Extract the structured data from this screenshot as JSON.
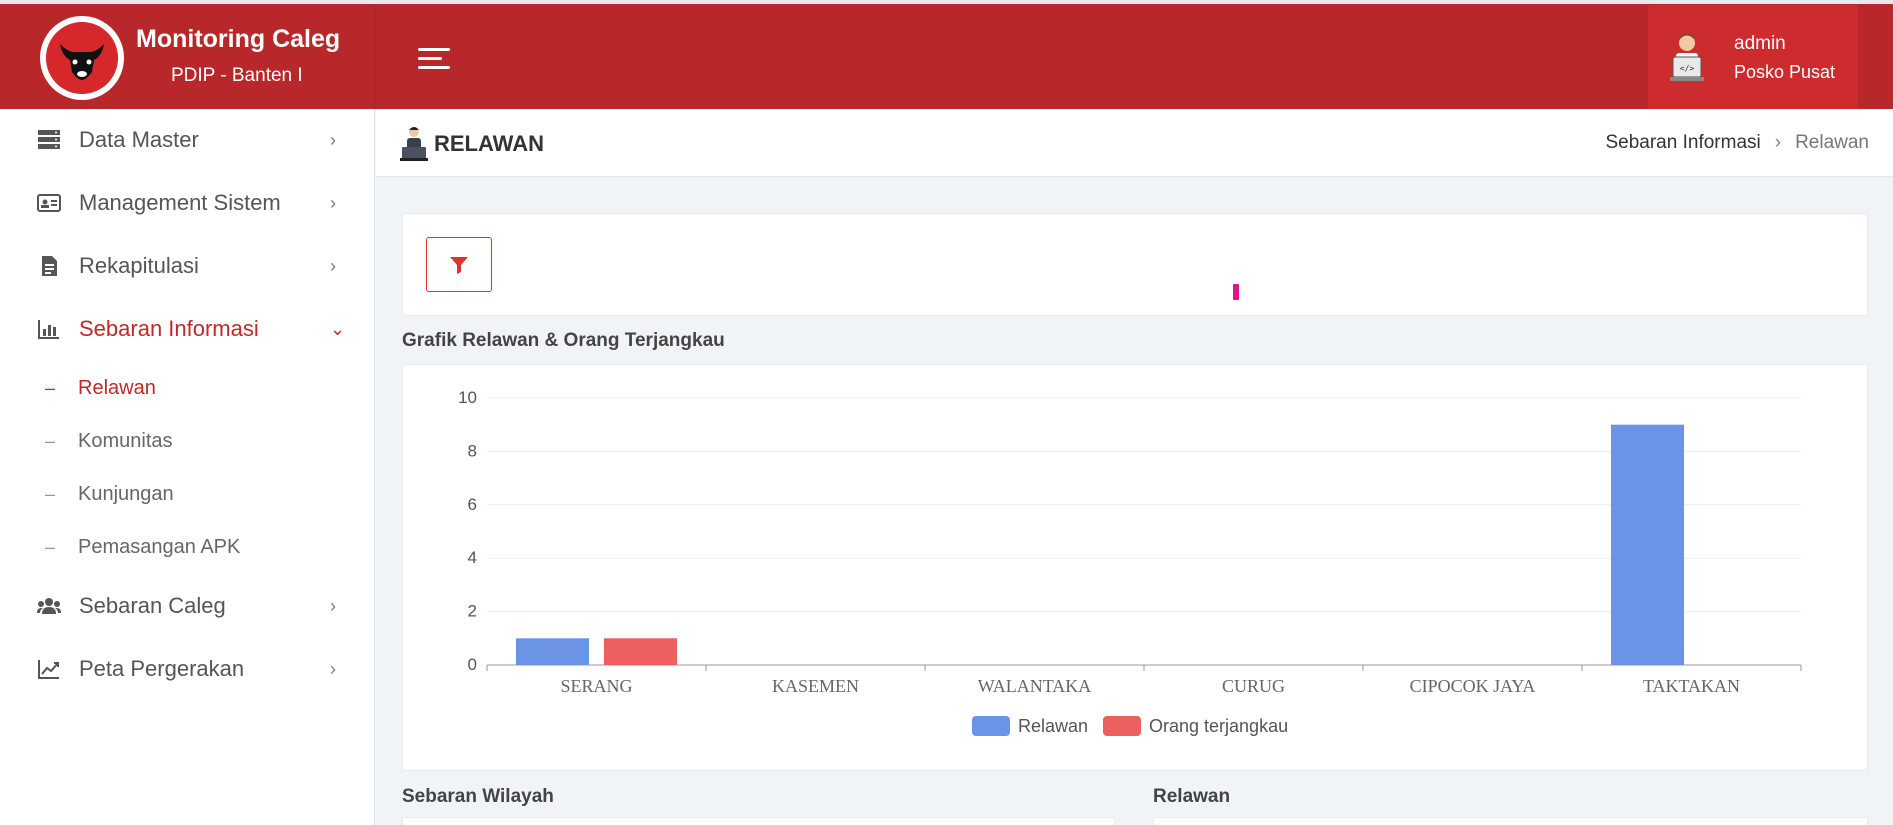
{
  "header": {
    "app_title": "Monitoring Caleg",
    "app_subtitle": "PDIP - Banten I",
    "user_name": "admin",
    "user_role": "Posko Pusat"
  },
  "sidebar": {
    "items": [
      {
        "label": "Data Master",
        "icon": "database-icon"
      },
      {
        "label": "Management Sistem",
        "icon": "id-card-icon"
      },
      {
        "label": "Rekapitulasi",
        "icon": "document-icon"
      },
      {
        "label": "Sebaran Informasi",
        "icon": "bar-chart-icon",
        "active": true
      },
      {
        "label": "Sebaran Caleg",
        "icon": "users-icon"
      },
      {
        "label": "Peta Pergerakan",
        "icon": "line-chart-icon"
      }
    ],
    "sub_items": [
      {
        "label": "Relawan",
        "active": true
      },
      {
        "label": "Komunitas"
      },
      {
        "label": "Kunjungan"
      },
      {
        "label": "Pemasangan APK"
      }
    ]
  },
  "page": {
    "title": "RELAWAN",
    "breadcrumb": [
      "Sebaran Informasi",
      "Relawan"
    ],
    "chart_section_title": "Grafik Relawan & Orang Terjangkau",
    "bottom_left_title": "Sebaran Wilayah",
    "bottom_right_title": "Relawan"
  },
  "colors": {
    "brand": "#b8282a",
    "series_relawan": "#6b93e6",
    "series_orang": "#ee5f5f"
  },
  "chart_data": {
    "type": "bar",
    "title": "",
    "xlabel": "",
    "ylabel": "",
    "categories": [
      "SERANG",
      "KASEMEN",
      "WALANTAKA",
      "CURUG",
      "CIPOCOK JAYA",
      "TAKTAKAN"
    ],
    "series": [
      {
        "name": "Relawan",
        "values": [
          1,
          0,
          0,
          0,
          0,
          9
        ]
      },
      {
        "name": "Orang terjangkau",
        "values": [
          1,
          0,
          0,
          0,
          0,
          0
        ]
      }
    ],
    "ylim": [
      0,
      10
    ],
    "yticks": [
      0,
      2,
      4,
      6,
      8,
      10
    ],
    "grid": true,
    "legend_position": "bottom-center"
  }
}
